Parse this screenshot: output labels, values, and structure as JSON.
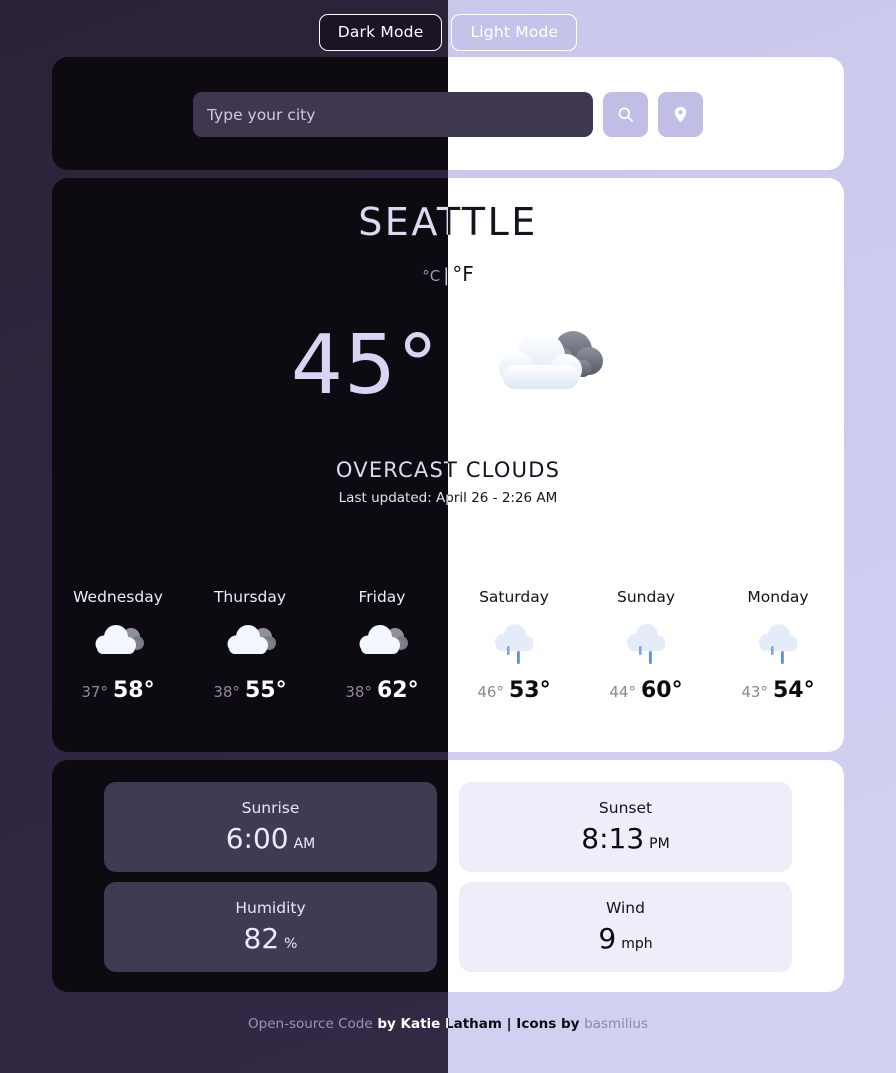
{
  "theme_toggle": {
    "dark_label": "Dark Mode",
    "light_label": "Light Mode"
  },
  "search": {
    "placeholder": "Type your city",
    "value": "",
    "search_icon": "search-icon",
    "location_icon": "map-pin-icon"
  },
  "current": {
    "city": "SEATTLE",
    "unit_celsius": "°C",
    "unit_separator": "|",
    "unit_fahrenheit": "°F",
    "temperature": "45°",
    "icon": "overcast-clouds-icon",
    "condition": "OVERCAST CLOUDS",
    "last_updated": "Last updated: April 26 - 2:26 AM"
  },
  "forecast": [
    {
      "day": "Wednesday",
      "icon": "overcast-clouds-icon",
      "min": "37°",
      "max": "58°"
    },
    {
      "day": "Thursday",
      "icon": "overcast-clouds-icon",
      "min": "38°",
      "max": "55°"
    },
    {
      "day": "Friday",
      "icon": "overcast-clouds-icon",
      "min": "38°",
      "max": "62°"
    },
    {
      "day": "Saturday",
      "icon": "rain-icon",
      "min": "46°",
      "max": "53°"
    },
    {
      "day": "Sunday",
      "icon": "rain-icon",
      "min": "44°",
      "max": "60°"
    },
    {
      "day": "Monday",
      "icon": "rain-icon",
      "min": "43°",
      "max": "54°"
    }
  ],
  "details": [
    {
      "label": "Sunrise",
      "value": "6:00",
      "unit": "AM"
    },
    {
      "label": "Sunset",
      "value": "8:13",
      "unit": "PM"
    },
    {
      "label": "Humidity",
      "value": "82",
      "unit": "%"
    },
    {
      "label": "Wind",
      "value": "9",
      "unit": "mph"
    }
  ],
  "footer": {
    "code_link": "Open-source Code",
    "middle": " by Katie Latham | Icons by ",
    "icons_link": "basmilius"
  },
  "colors": {
    "dark_bg": "#2b2438",
    "dark_panel": "#0d0a12",
    "dark_card": "#413a53",
    "light_bg": "#c8c6ea",
    "light_panel": "#ffffff",
    "light_card": "#eeedfa",
    "accent": "#c1bee6",
    "rain_drop": "#6f9fe0"
  }
}
